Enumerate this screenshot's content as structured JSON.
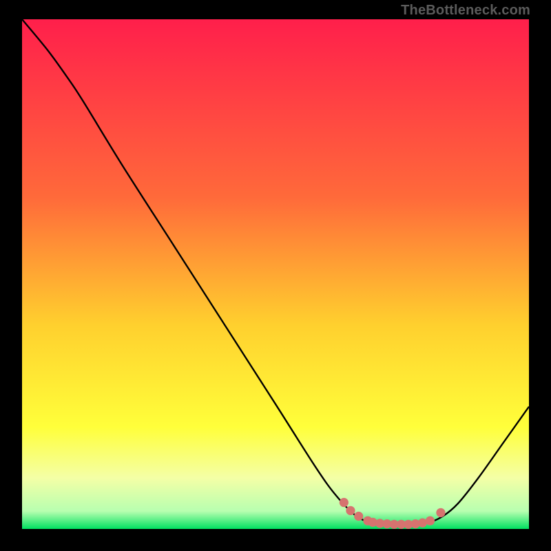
{
  "watermark": {
    "text": "TheBottleneck.com"
  },
  "chart_data": {
    "type": "line",
    "title": "",
    "xlabel": "",
    "ylabel": "",
    "xlim": [
      0,
      100
    ],
    "ylim": [
      0,
      100
    ],
    "gradient_stops": [
      {
        "offset": 0.0,
        "color": "#ff1f4b"
      },
      {
        "offset": 0.35,
        "color": "#ff6a3a"
      },
      {
        "offset": 0.6,
        "color": "#ffd02e"
      },
      {
        "offset": 0.8,
        "color": "#ffff3a"
      },
      {
        "offset": 0.9,
        "color": "#f4ffa6"
      },
      {
        "offset": 0.965,
        "color": "#b8ffb0"
      },
      {
        "offset": 1.0,
        "color": "#00e060"
      }
    ],
    "series": [
      {
        "name": "curve",
        "color": "#000000",
        "points": [
          {
            "x": 0.0,
            "y": 100.0
          },
          {
            "x": 5.0,
            "y": 94.0
          },
          {
            "x": 9.0,
            "y": 88.5
          },
          {
            "x": 12.0,
            "y": 84.0
          },
          {
            "x": 20.0,
            "y": 71.0
          },
          {
            "x": 30.0,
            "y": 55.5
          },
          {
            "x": 40.0,
            "y": 40.0
          },
          {
            "x": 50.0,
            "y": 24.5
          },
          {
            "x": 58.0,
            "y": 12.0
          },
          {
            "x": 62.0,
            "y": 6.5
          },
          {
            "x": 66.0,
            "y": 2.5
          },
          {
            "x": 70.0,
            "y": 1.0
          },
          {
            "x": 76.0,
            "y": 0.8
          },
          {
            "x": 80.0,
            "y": 1.2
          },
          {
            "x": 83.0,
            "y": 2.5
          },
          {
            "x": 86.0,
            "y": 5.0
          },
          {
            "x": 90.0,
            "y": 10.0
          },
          {
            "x": 95.0,
            "y": 17.0
          },
          {
            "x": 100.0,
            "y": 24.0
          }
        ]
      }
    ],
    "markers": {
      "name": "valley-dots",
      "color": "#d6736f",
      "radius_frac": 0.009,
      "points": [
        {
          "x": 63.5,
          "y": 5.2
        },
        {
          "x": 64.8,
          "y": 3.6
        },
        {
          "x": 66.4,
          "y": 2.5
        },
        {
          "x": 68.2,
          "y": 1.6
        },
        {
          "x": 69.2,
          "y": 1.3
        },
        {
          "x": 70.6,
          "y": 1.1
        },
        {
          "x": 72.0,
          "y": 1.0
        },
        {
          "x": 73.4,
          "y": 0.9
        },
        {
          "x": 74.8,
          "y": 0.9
        },
        {
          "x": 76.2,
          "y": 0.9
        },
        {
          "x": 77.6,
          "y": 1.0
        },
        {
          "x": 79.0,
          "y": 1.2
        },
        {
          "x": 80.5,
          "y": 1.6
        },
        {
          "x": 82.6,
          "y": 3.2
        }
      ]
    }
  }
}
